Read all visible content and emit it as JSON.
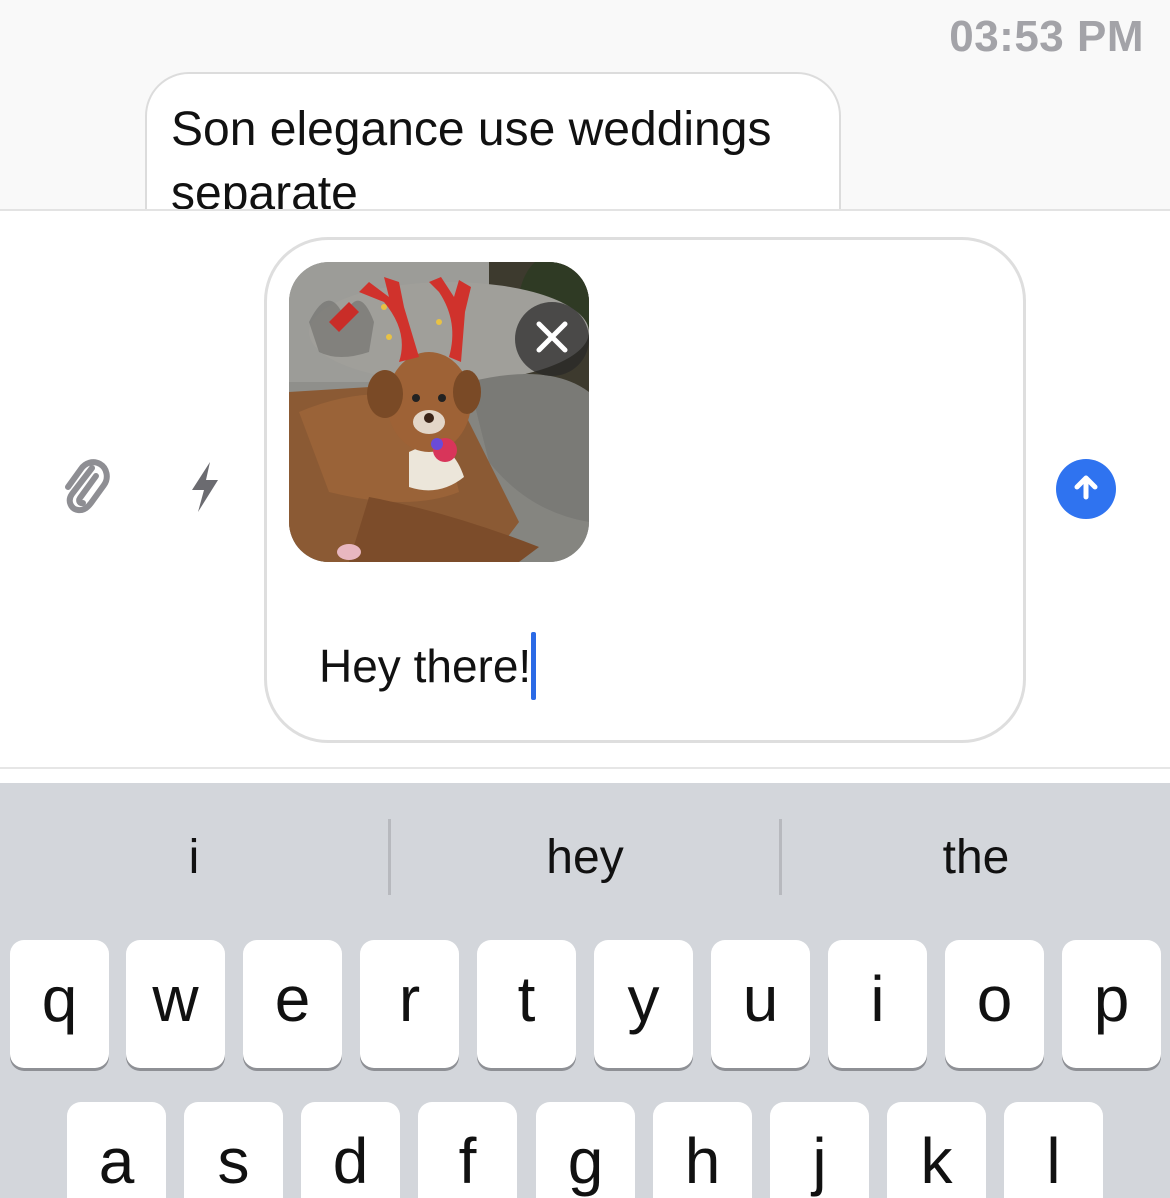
{
  "chat": {
    "timestamp": "03:53 PM",
    "message": "Son elegance use weddings separate"
  },
  "composer": {
    "attachment_image": "dog-with-reindeer-antlers-photo",
    "input_value": "Hey there!",
    "icons": {
      "attach": "paperclip-icon",
      "quick": "lightning-bolt-icon",
      "remove": "close-icon",
      "send": "arrow-up-icon"
    },
    "accent_color": "#2f73f0"
  },
  "keyboard": {
    "suggestions": [
      "i",
      "hey",
      "the"
    ],
    "row1": [
      "q",
      "w",
      "e",
      "r",
      "t",
      "y",
      "u",
      "i",
      "o",
      "p"
    ],
    "row2": [
      "a",
      "s",
      "d",
      "f",
      "g",
      "h",
      "j",
      "k",
      "l"
    ]
  }
}
